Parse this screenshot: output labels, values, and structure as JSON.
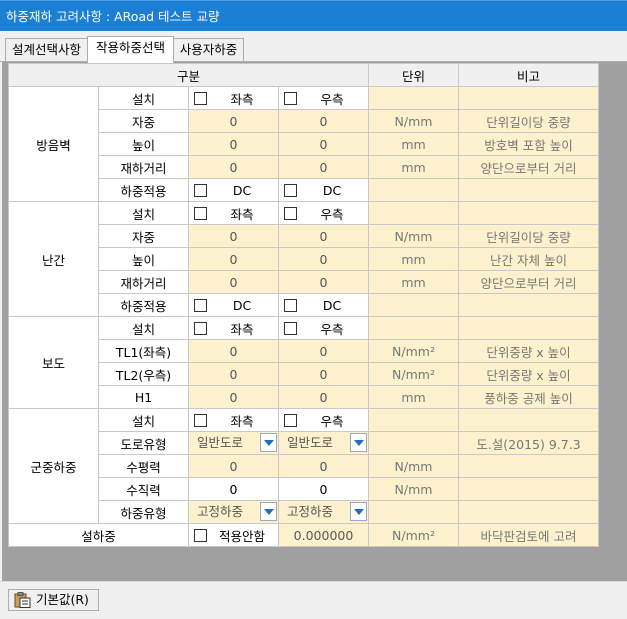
{
  "window": {
    "title": "하중재하 고려사항 : ARoad 테스트 교량"
  },
  "tabs": [
    {
      "label": "설계선택사항"
    },
    {
      "label": "작용하중선택"
    },
    {
      "label": "사용자하중"
    }
  ],
  "grid": {
    "headers": {
      "category": "구분",
      "unit": "단위",
      "note": "비고"
    },
    "noise_wall": {
      "title": "방음벽",
      "install": {
        "label": "설치",
        "left": "좌측",
        "right": "우측"
      },
      "weight": {
        "label": "자중",
        "left": "0",
        "right": "0",
        "unit": "N/mm",
        "note": "단위길이당 중량"
      },
      "height": {
        "label": "높이",
        "left": "0",
        "right": "0",
        "unit": "mm",
        "note": "방호벽 포함 높이"
      },
      "lever": {
        "label": "재하거리",
        "left": "0",
        "right": "0",
        "unit": "mm",
        "note": "양단으로부터 거리"
      },
      "load_apply": {
        "label": "하중적용",
        "left": "DC",
        "right": "DC"
      }
    },
    "railing": {
      "title": "난간",
      "install": {
        "label": "설치",
        "left": "좌측",
        "right": "우측"
      },
      "weight": {
        "label": "자중",
        "left": "0",
        "right": "0",
        "unit": "N/mm",
        "note": "단위길이당 중량"
      },
      "height": {
        "label": "높이",
        "left": "0",
        "right": "0",
        "unit": "mm",
        "note": "난간 자체 높이"
      },
      "lever": {
        "label": "재하거리",
        "left": "0",
        "right": "0",
        "unit": "mm",
        "note": "양단으로부터 거리"
      },
      "load_apply": {
        "label": "하중적용",
        "left": "DC",
        "right": "DC"
      }
    },
    "sidewalk": {
      "title": "보도",
      "install": {
        "label": "설치",
        "left": "좌측",
        "right": "우측"
      },
      "tl1": {
        "label": "TL1(좌측)",
        "left": "0",
        "right": "0",
        "unit": "N/mm²",
        "note": "단위중량 x 높이"
      },
      "tl2": {
        "label": "TL2(우측)",
        "left": "0",
        "right": "0",
        "unit": "N/mm²",
        "note": "단위중량 x 높이"
      },
      "h1": {
        "label": "H1",
        "left": "0",
        "right": "0",
        "unit": "mm",
        "note": "풍하중 공제 높이"
      }
    },
    "crowd": {
      "title": "군중하중",
      "install": {
        "label": "설치",
        "left": "좌측",
        "right": "우측"
      },
      "road_type": {
        "label": "도로유형",
        "left": "일반도로",
        "right": "일반도로",
        "note": "도.설(2015) 9.7.3"
      },
      "horizontal": {
        "label": "수평력",
        "left": "0",
        "right": "0",
        "unit": "N/mm"
      },
      "vertical": {
        "label": "수직력",
        "left": "0",
        "right": "0",
        "unit": "N/mm"
      },
      "load_type": {
        "label": "하중유형",
        "left": "고정하중",
        "right": "고정하중"
      }
    },
    "snow": {
      "title": "설하중",
      "apply_label": "적용안함",
      "value": "0.000000",
      "unit": "N/mm²",
      "note": "바닥판검토에 고려"
    }
  },
  "footer": {
    "default_button": "기본값(R)"
  }
}
